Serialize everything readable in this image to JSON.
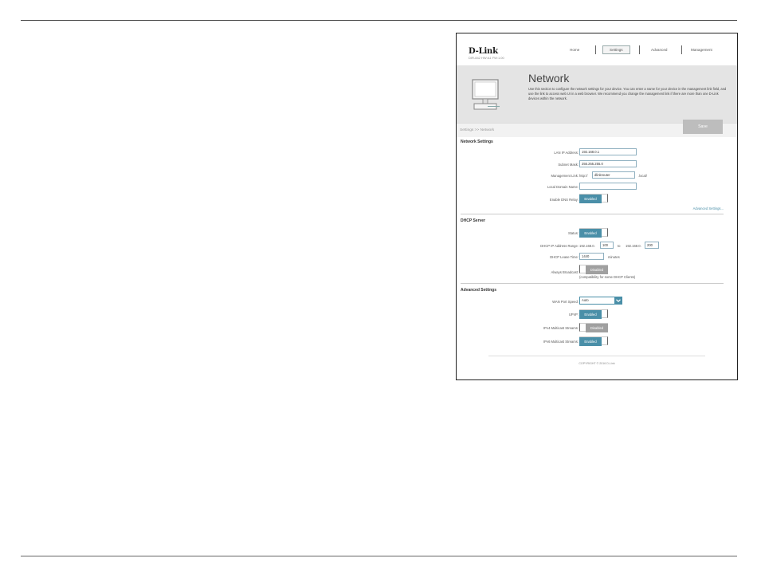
{
  "header": {
    "brand": "D-Link",
    "model": "DIR-842   HW:A1   FW:1.00",
    "nav": [
      "Home",
      "Settings",
      "Advanced",
      "Management"
    ]
  },
  "banner": {
    "title": "Network",
    "description": "Use this section to configure the network settings for your device. You can enter a name for your device in the management link field, and use the link to access web UI in a web browser. We recommend you change the management link if there are more than one D-Link devices within the network."
  },
  "breadcrumb": "Settings >> Network",
  "save_label": "Save",
  "network_settings": {
    "title": "Network Settings",
    "lan_ip_label": "LAN IP Address:",
    "lan_ip_value": "192.168.0.1",
    "subnet_label": "Subnet Mask:",
    "subnet_value": "255.255.255.0",
    "mgmt_label": "Management Link:",
    "mgmt_prefix": "http://",
    "mgmt_value": "dlinkrouter",
    "mgmt_suffix": ".local/",
    "domain_label": "Local Domain Name:",
    "domain_value": "",
    "dns_relay_label": "Enable DNS Relay:",
    "dns_relay_state": "Enabled",
    "advanced_link": "Advanced Settings..."
  },
  "dhcp_server": {
    "title": "DHCP Server",
    "status_label": "Status:",
    "status_state": "Enabled",
    "range_label": "DHCP IP Address Range:",
    "range_prefix_start": "192.168.0.",
    "range_start": "100",
    "range_to": "to",
    "range_prefix_end": "192.168.0.",
    "range_end": "200",
    "lease_label": "DHCP Lease Time:",
    "lease_value": "1440",
    "lease_unit": "minutes",
    "broadcast_label": "Always Broadcast:",
    "broadcast_state": "Disabled",
    "broadcast_note": "(compatibility for some DHCP Clients)"
  },
  "advanced_settings": {
    "title": "Advanced Settings",
    "wan_speed_label": "WAN Port Speed:",
    "wan_speed_value": "Auto",
    "upnp_label": "UPnP:",
    "upnp_state": "Enabled",
    "ipv4_mc_label": "IPv4 Multicast Streams:",
    "ipv4_mc_state": "Disabled",
    "ipv6_mc_label": "IPv6 Multicast Streams:",
    "ipv6_mc_state": "Enabled"
  },
  "copyright": "COPYRIGHT © 2016 D-Link",
  "colors": {
    "accent": "#4a8fa8",
    "disabled": "#a0a0a0",
    "banner": "#e4e4e4"
  }
}
